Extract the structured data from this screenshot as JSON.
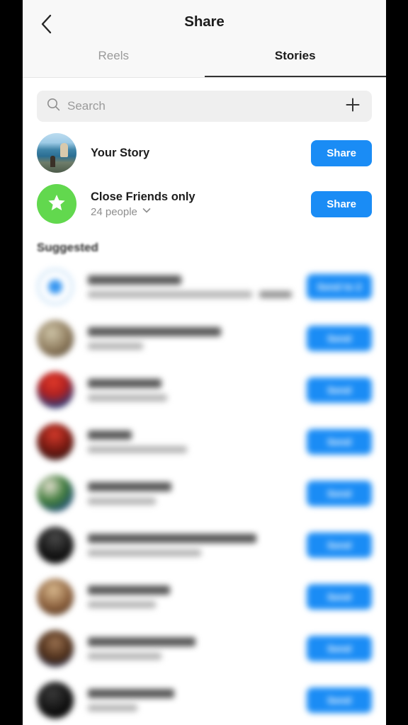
{
  "header": {
    "title": "Share",
    "back_icon": "chevron-left-icon",
    "tabs": [
      {
        "label": "Reels",
        "active": false
      },
      {
        "label": "Stories",
        "active": true
      }
    ]
  },
  "search": {
    "icon": "search-icon",
    "placeholder": "Search",
    "value": "",
    "add_icon": "plus-icon"
  },
  "destinations": [
    {
      "title": "Your Story",
      "subtitle": "",
      "avatar": "your-story-photo",
      "button": "Share"
    },
    {
      "title": "Close Friends only",
      "subtitle": "24 people",
      "subtitle_icon": "chevron-down-icon",
      "avatar": "close-friends-star",
      "button": "Share"
    }
  ],
  "suggested": {
    "heading": "Suggested",
    "rows": [
      {
        "avatar": "broadcast-channel-icon",
        "button": "Send to 2",
        "name_width": 132,
        "sub_width": 232,
        "has_tail": true,
        "tail_width": 46
      },
      {
        "avatar": "avatar-tan",
        "button": "Send",
        "name_width": 188,
        "sub_width": 78,
        "has_tail": false
      },
      {
        "avatar": "avatar-red-blue",
        "button": "Send",
        "name_width": 104,
        "sub_width": 112,
        "has_tail": false
      },
      {
        "avatar": "avatar-dark-red",
        "button": "Send",
        "name_width": 62,
        "sub_width": 140,
        "has_tail": false
      },
      {
        "avatar": "avatar-green-multi",
        "button": "Send",
        "name_width": 118,
        "sub_width": 96,
        "has_tail": false
      },
      {
        "avatar": "avatar-black",
        "button": "Send",
        "name_width": 238,
        "sub_width": 160,
        "has_tail": false
      },
      {
        "avatar": "avatar-brown",
        "button": "Send",
        "name_width": 116,
        "sub_width": 96,
        "has_tail": false
      },
      {
        "avatar": "avatar-dark-brown",
        "button": "Send",
        "name_width": 152,
        "sub_width": 104,
        "has_tail": false
      },
      {
        "avatar": "avatar-black-2",
        "button": "Send",
        "name_width": 122,
        "sub_width": 70,
        "has_tail": false
      }
    ]
  },
  "colors": {
    "accent_blue": "#1a8cf5",
    "close_friends_green": "#62d84e",
    "header_bg": "#f8f8f8",
    "search_bg": "#efefef",
    "text_primary": "#1c1c1c",
    "text_secondary": "#8e8e8e",
    "frame_black": "#000000"
  }
}
